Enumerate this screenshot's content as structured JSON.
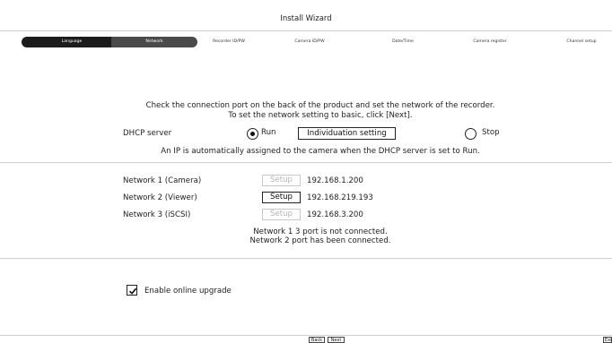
{
  "window": {
    "title": "Install Wizard"
  },
  "steps": [
    {
      "label": "Language",
      "state": "done"
    },
    {
      "label": "Network",
      "state": "current"
    },
    {
      "label": "Recorder ID/PW",
      "state": "pending"
    },
    {
      "label": "Camera ID/PW",
      "state": "pending"
    },
    {
      "label": "Date/Time",
      "state": "pending"
    },
    {
      "label": "Camera register",
      "state": "pending"
    },
    {
      "label": "Channel setup",
      "state": "pending"
    }
  ],
  "instructions": {
    "line1": "Check the connection port on the back of the product and set the network of the recorder.",
    "line2": "To set the network setting to basic, click [Next]."
  },
  "dhcp": {
    "label": "DHCP server",
    "run_label": "Run",
    "individuation_button": "Individuation setting",
    "stop_label": "Stop",
    "selected": "Run",
    "note": "An IP is automatically assigned to the camera when the DHCP server is set to Run."
  },
  "networks": [
    {
      "label": "Network 1 (Camera)",
      "button": "Setup",
      "enabled": false,
      "ip": "192.168.1.200"
    },
    {
      "label": "Network 2 (Viewer)",
      "button": "Setup",
      "enabled": true,
      "ip": "192.168.219.193"
    },
    {
      "label": "Network 3 (iSCSI)",
      "button": "Setup",
      "enabled": false,
      "ip": "192.168.3.200"
    }
  ],
  "port_status": {
    "line1": "Network 1 3  port is not connected.",
    "line2": "Network 2  port has been connected."
  },
  "upgrade": {
    "label": "Enable online upgrade",
    "checked": true
  },
  "footer": {
    "back": "Back",
    "next": "Next",
    "exit": "Exit"
  },
  "colors": {
    "stepper_active": "#1c1c1c",
    "stepper_current": "#4a4a4a",
    "disabled_text": "#b5b5b5"
  },
  "icons": {
    "radio_selected": "radio-filled-icon",
    "radio_empty": "radio-empty-icon",
    "checkbox": "checkmark-icon"
  }
}
